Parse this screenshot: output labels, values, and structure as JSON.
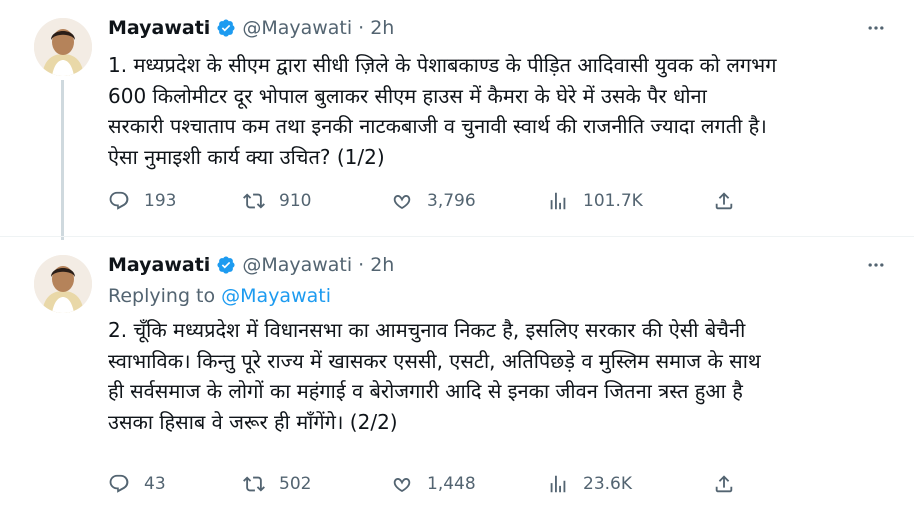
{
  "tweets": [
    {
      "author_name": "Mayawati",
      "handle": "@Mayawati",
      "separator": "·",
      "time": "2h",
      "text": "1. मध्यप्रदेश के सीएम द्वारा सीधी ज़िले के पेशाबकाण्ड के पीड़ित आदिवासी युवक को लगभग\n600 किलोमीटर दूर भोपाल बुलाकर सीएम हाउस में कैमरा के घेरे में उसके पैर धोना\nसरकारी पश्चाताप कम तथा इनकी नाटकबाजी व चुनावी स्वार्थ की राजनीति ज्यादा लगती है।\nऐसा नुमाइशी कार्य क्या उचित? (1/2)",
      "replies": "193",
      "retweets": "910",
      "likes": "3,796",
      "views": "101.7K"
    },
    {
      "author_name": "Mayawati",
      "handle": "@Mayawati",
      "separator": "·",
      "time": "2h",
      "replying_prefix": "Replying to ",
      "replying_to": "@Mayawati",
      "text": "2. चूँकि मध्यप्रदेश में विधानसभा का आमचुनाव निकट है, इसलिए सरकार की ऐसी बेचैनी\nस्वाभाविक। किन्तु पूरे राज्य में खासकर एससी, एसटी, अतिपिछड़े व मुस्लिम समाज के साथ\nही सर्वसमाज के लोगों का महंगाई व बेरोजगारी आदि से इनका जीवन जितना त्रस्त हुआ है\nउसका हिसाब वे जरूर ही माँगेंगे। (2/2)",
      "replies": "43",
      "retweets": "502",
      "likes": "1,448",
      "views": "23.6K"
    }
  ],
  "icons": {
    "verified": "verified-badge-icon",
    "more": "more-icon",
    "reply": "reply-icon",
    "retweet": "retweet-icon",
    "like": "like-icon",
    "views": "views-icon",
    "share": "share-icon"
  },
  "colors": {
    "accent": "#1d9bf0",
    "secondary_text": "#536471",
    "primary_text": "#0f1419",
    "thread_line": "#cfd9de"
  }
}
